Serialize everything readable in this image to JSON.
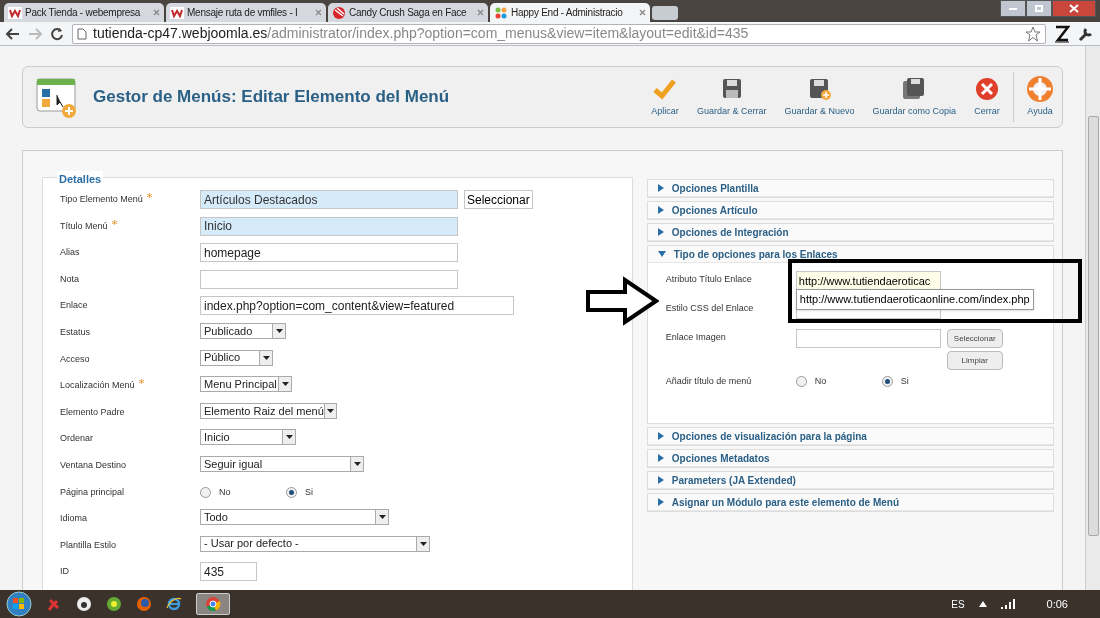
{
  "browser": {
    "tabs": [
      {
        "title": "Pack Tienda - webempresa",
        "kind": "w",
        "selected": false
      },
      {
        "title": "Mensaje ruta de vmfiles - I",
        "kind": "w",
        "selected": false
      },
      {
        "title": "Candy Crush Saga en Face",
        "kind": "candy",
        "selected": false
      },
      {
        "title": "Happy End - Administracio",
        "kind": "joomla",
        "selected": true
      }
    ],
    "url": {
      "host": "tutienda-cp47.webjoomla.es",
      "path": "/administrator/index.php?option=com_menus&view=item&layout=edit&id=435"
    }
  },
  "toolbar": {
    "title": "Gestor de Menús: Editar Elemento del Menú",
    "buttons": [
      {
        "label": "Aplicar",
        "kind": "apply"
      },
      {
        "label": "Guardar & Cerrar",
        "kind": "save"
      },
      {
        "label": "Guardar & Nuevo",
        "kind": "save-new"
      },
      {
        "label": "Guardar como Copia",
        "kind": "copy"
      },
      {
        "label": "Cerrar",
        "kind": "close"
      },
      {
        "label": "Ayuda",
        "kind": "help"
      }
    ]
  },
  "details": {
    "legend": "Detalles",
    "fields": [
      {
        "label": "Tipo Elemento Menú",
        "required": true,
        "kind": "text",
        "value": "Artículos Destacados",
        "highlighted": true,
        "button": "Seleccionar"
      },
      {
        "label": "Título Menú",
        "required": true,
        "kind": "text",
        "value": "Inicio",
        "highlighted": true
      },
      {
        "label": "Alias",
        "required": false,
        "kind": "text",
        "value": "homepage",
        "highlighted": false
      },
      {
        "label": "Nota",
        "required": false,
        "kind": "text",
        "highlighted": false
      },
      {
        "label": "Enlace",
        "required": false,
        "kind": "text",
        "value": "index.php?option=com_content&view=featured",
        "highlighted": false
      },
      {
        "label": "Estatus",
        "required": false,
        "kind": "select",
        "value": "Publicado"
      },
      {
        "label": "Acceso",
        "required": false,
        "kind": "select",
        "value": "Público"
      },
      {
        "label": "Localización Menú",
        "required": true,
        "kind": "select",
        "value": "Menu Principal"
      },
      {
        "label": "Elemento Padre",
        "required": false,
        "kind": "select",
        "value": "Elemento Raiz del menú"
      },
      {
        "label": "Ordenar",
        "required": false,
        "kind": "select",
        "value": "Inicio"
      },
      {
        "label": "Ventana Destino",
        "required": false,
        "kind": "select",
        "value": "Seguir igual"
      },
      {
        "label": "Página principal",
        "required": false,
        "kind": "radio",
        "options": [
          {
            "label": "No",
            "selected": false
          },
          {
            "label": "Si",
            "selected": true
          }
        ]
      },
      {
        "label": "Idioma",
        "required": false,
        "kind": "select",
        "value": "Todo"
      },
      {
        "label": "Plantilla Estilo",
        "required": false,
        "kind": "select",
        "value": "- Usar por defecto -"
      },
      {
        "label": "ID",
        "required": false,
        "kind": "readonly",
        "value": "435"
      }
    ]
  },
  "options": {
    "sections": [
      {
        "title": "Opciones Plantilla",
        "expanded": false
      },
      {
        "title": "Opciones Artículo",
        "expanded": false
      },
      {
        "title": "Opciones de Integración",
        "expanded": false
      },
      {
        "title": "Tipo de opciones para los Enlaces",
        "expanded": true,
        "fields": [
          {
            "label": "Atributo Título Enlace",
            "kind": "text",
            "value": "http://www.tutiendaeroticac",
            "suggestion": "http://www.tutiendaeroticaonline.com/index.php"
          },
          {
            "label": "Estilo CSS del Enlace",
            "kind": "text"
          },
          {
            "label": "Enlace Imagen",
            "kind": "image",
            "buttons": [
              "Seleccionar",
              "Limpiar"
            ]
          },
          {
            "label": "Añadir título de menú",
            "kind": "radio",
            "options": [
              {
                "label": "No",
                "selected": false
              },
              {
                "label": "Si",
                "selected": true
              }
            ]
          }
        ]
      },
      {
        "title": "Opciones de visualización para la página",
        "expanded": false
      },
      {
        "title": "Opciones Metadatos",
        "expanded": false
      },
      {
        "title": "Parameters (JA Extended)",
        "expanded": false
      },
      {
        "title": "Asignar un Módulo para este elemento de Menú",
        "expanded": false
      }
    ]
  },
  "taskbar": {
    "language": "ES",
    "time": "0:06"
  }
}
